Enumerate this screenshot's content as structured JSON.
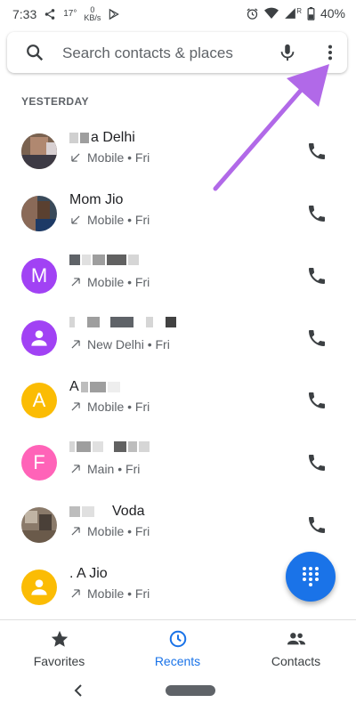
{
  "status": {
    "time": "7:33",
    "temp": "17°",
    "kb_value": "0",
    "kb_unit": "KB/s",
    "signal_label": "R",
    "battery": "40%"
  },
  "search": {
    "placeholder": "Search contacts & places"
  },
  "section_label": "YESTERDAY",
  "calls": [
    {
      "name": "a Delhi",
      "detail": "Mobile • Fri",
      "direction": "incoming",
      "avatar_type": "photo"
    },
    {
      "name": "Mom Jio",
      "detail": "Mobile • Fri",
      "direction": "incoming",
      "avatar_type": "photo"
    },
    {
      "name": "",
      "detail": "Mobile • Fri",
      "direction": "outgoing",
      "avatar_type": "letter",
      "avatar_letter": "M",
      "avatar_color": "#a142f4"
    },
    {
      "name": "",
      "detail": "New Delhi • Fri",
      "direction": "outgoing",
      "avatar_type": "person",
      "avatar_color": "#a142f4"
    },
    {
      "name": "A",
      "detail": "Mobile • Fri",
      "direction": "outgoing",
      "avatar_type": "letter",
      "avatar_letter": "A",
      "avatar_color": "#fbbc04"
    },
    {
      "name": "",
      "detail": "Main • Fri",
      "direction": "outgoing",
      "avatar_type": "letter",
      "avatar_letter": "F",
      "avatar_color": "#ff63b8"
    },
    {
      "name": "Voda",
      "detail": "Mobile • Fri",
      "direction": "outgoing",
      "avatar_type": "photo"
    },
    {
      "name": ". A Jio",
      "detail": "Mobile • Fri",
      "direction": "outgoing",
      "avatar_type": "person",
      "avatar_color": "#fbbc04"
    }
  ],
  "nav": {
    "favorites": "Favorites",
    "recents": "Recents",
    "contacts": "Contacts",
    "active_color": "#1a73e8"
  },
  "icons": {
    "search": "search-icon",
    "mic": "mic-icon",
    "more": "more-vert-icon",
    "call": "phone-icon",
    "dialpad": "dialpad-icon",
    "star": "star-icon",
    "clock": "clock-icon",
    "people": "people-icon"
  }
}
